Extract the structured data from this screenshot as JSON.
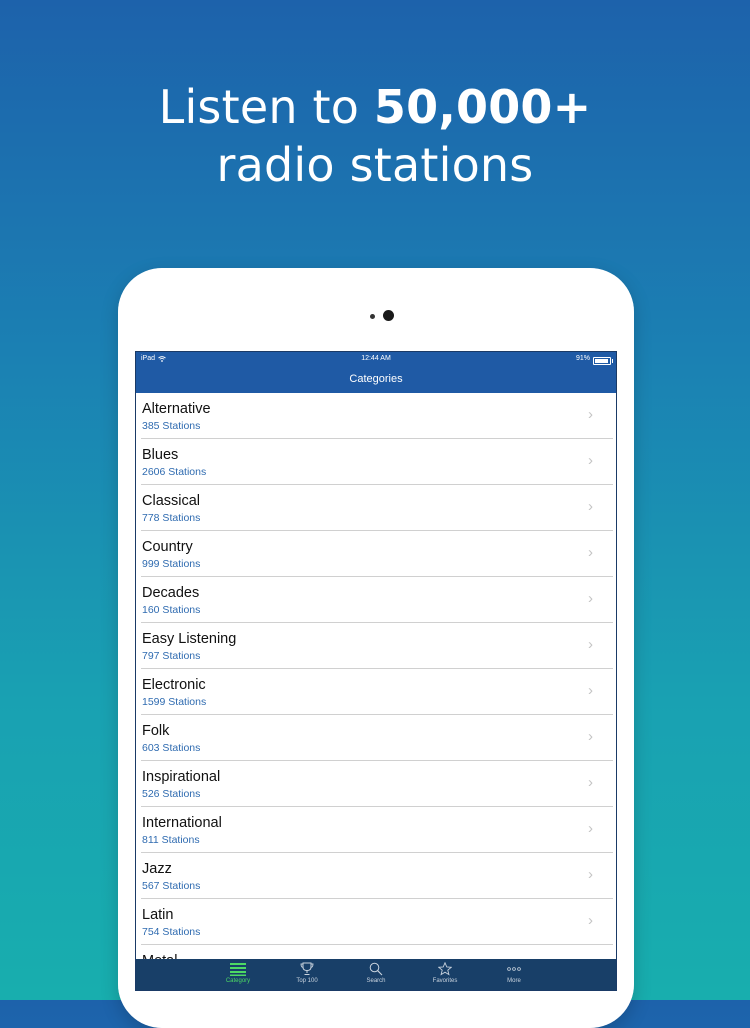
{
  "headline": {
    "line1_prefix": "Listen to ",
    "line1_bold": "50,000+",
    "line2": "radio stations"
  },
  "status_bar": {
    "device": "iPad",
    "time": "12:44 AM",
    "battery_percent": "91%",
    "battery_level": 0.91
  },
  "nav": {
    "title": "Categories"
  },
  "categories": [
    {
      "name": "Alternative",
      "count": "385 Stations"
    },
    {
      "name": "Blues",
      "count": "2606 Stations"
    },
    {
      "name": "Classical",
      "count": "778 Stations"
    },
    {
      "name": "Country",
      "count": "999 Stations"
    },
    {
      "name": "Decades",
      "count": "160 Stations"
    },
    {
      "name": "Easy Listening",
      "count": "797 Stations"
    },
    {
      "name": "Electronic",
      "count": "1599 Stations"
    },
    {
      "name": "Folk",
      "count": "603 Stations"
    },
    {
      "name": "Inspirational",
      "count": "526 Stations"
    },
    {
      "name": "International",
      "count": "811 Stations"
    },
    {
      "name": "Jazz",
      "count": "567 Stations"
    },
    {
      "name": "Latin",
      "count": "754 Stations"
    },
    {
      "name": "Metal",
      "count": ""
    }
  ],
  "chevron": "›",
  "tabs": [
    {
      "label": "Category",
      "icon": "list-icon",
      "active": true
    },
    {
      "label": "Top 100",
      "icon": "trophy-icon",
      "active": false
    },
    {
      "label": "Search",
      "icon": "search-icon",
      "active": false
    },
    {
      "label": "Favorites",
      "icon": "star-icon",
      "active": false
    },
    {
      "label": "More",
      "icon": "more-icon",
      "active": false
    }
  ],
  "colors": {
    "nav_bar": "#1f5aa5",
    "tab_bar": "#183f68",
    "active_tab": "#4cd964",
    "station_count": "#2f6bb0"
  }
}
